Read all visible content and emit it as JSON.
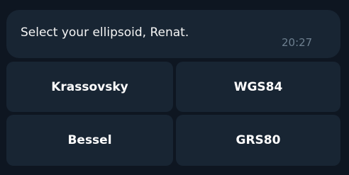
{
  "message": {
    "text": "Select your ellipsoid, Renat.",
    "time": "20:27"
  },
  "keyboard": {
    "buttons": [
      {
        "label": "Krassovsky"
      },
      {
        "label": "WGS84"
      },
      {
        "label": "Bessel"
      },
      {
        "label": "GRS80"
      }
    ]
  },
  "colors": {
    "background": "#0e1621",
    "bubble": "#182533",
    "text": "#f5f5f5",
    "time": "#6d7f8f"
  }
}
